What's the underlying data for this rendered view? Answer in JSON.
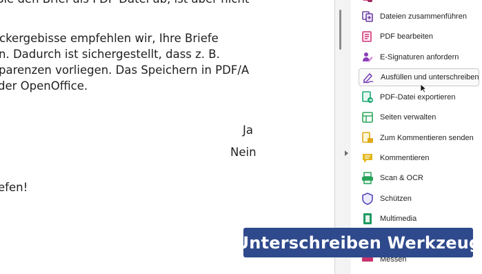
{
  "document": {
    "lines": [
      "Sie den Brief als PDF-Datei ab, ist aber nicht",
      "ckergebisse empfehlen wir, Ihre Briefe",
      "n. Dadurch ist sichergestellt, dass z. B.",
      "parenzen vorliegen. Das Speichern in PDF/A",
      "der OpenOffice.",
      "Ja",
      "Nein",
      "efen!"
    ]
  },
  "tools_panel": {
    "items": [
      {
        "label": "Dateien zusammenführen",
        "icon": "combine-files-icon",
        "color": "#6b3fa0"
      },
      {
        "label": "PDF bearbeiten",
        "icon": "edit-pdf-icon",
        "color": "#d2387c"
      },
      {
        "label": "E-Signaturen anfordern",
        "icon": "request-signatures-icon",
        "color": "#8b3fb5"
      },
      {
        "label": "Ausfüllen und unterschreiben",
        "icon": "fill-sign-icon",
        "color": "#7b3fb8"
      },
      {
        "label": "PDF-Datei exportieren",
        "icon": "export-pdf-icon",
        "color": "#1aa874"
      },
      {
        "label": "Seiten verwalten",
        "icon": "organize-pages-icon",
        "color": "#2aa55a"
      },
      {
        "label": "Zum Kommentieren senden",
        "icon": "send-for-comments-icon",
        "color": "#e1a91a"
      },
      {
        "label": "Kommentieren",
        "icon": "comment-icon",
        "color": "#e2b71b"
      },
      {
        "label": "Scan & OCR",
        "icon": "scan-ocr-icon",
        "color": "#28a35a"
      },
      {
        "label": "Schützen",
        "icon": "protect-icon",
        "color": "#5147b8"
      },
      {
        "label": "Multimedia",
        "icon": "multimedia-icon",
        "color": "#1f9a62"
      },
      {
        "label": "Messen",
        "icon": "measure-icon",
        "color": "#c8336e"
      }
    ],
    "active_item": "Ausfüllen und unterschreiben"
  },
  "overlay": {
    "caption": "Unterschreiben Werkzeug",
    "background": "#2f4a8c"
  }
}
